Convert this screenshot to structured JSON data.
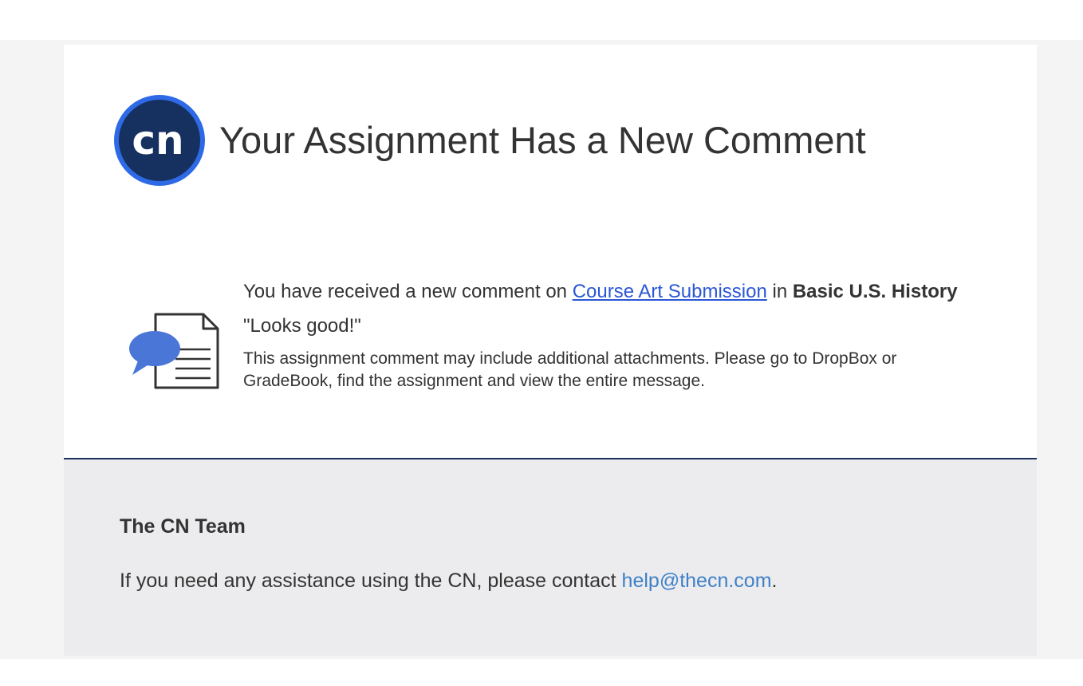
{
  "header": {
    "logo_text": "cn",
    "title": "Your Assignment Has a New Comment"
  },
  "message": {
    "intro_prefix": "You have received a new comment on ",
    "assignment_link": "Course Art Submission",
    "intro_mid": " in ",
    "course_name": "Basic U.S. History",
    "comment": "\"Looks good!\"",
    "note": "This assignment comment may include additional attachments. Please go to DropBox or GradeBook, find the assignment and view the entire message."
  },
  "footer": {
    "team": "The CN Team",
    "help_prefix": "If you need any assistance using the CN, please contact ",
    "help_email": "help@thecn.com",
    "help_suffix": "."
  },
  "colors": {
    "logo_ring": "#2f6ae6",
    "logo_fill": "#16305f",
    "link": "#2b57d6",
    "email_link": "#3f80c8",
    "footer_border": "#1a2f5c",
    "chat_bubble": "#4a76d8"
  },
  "icons": {
    "logo": "cn-logo-icon",
    "comment_document": "comment-document-icon"
  }
}
